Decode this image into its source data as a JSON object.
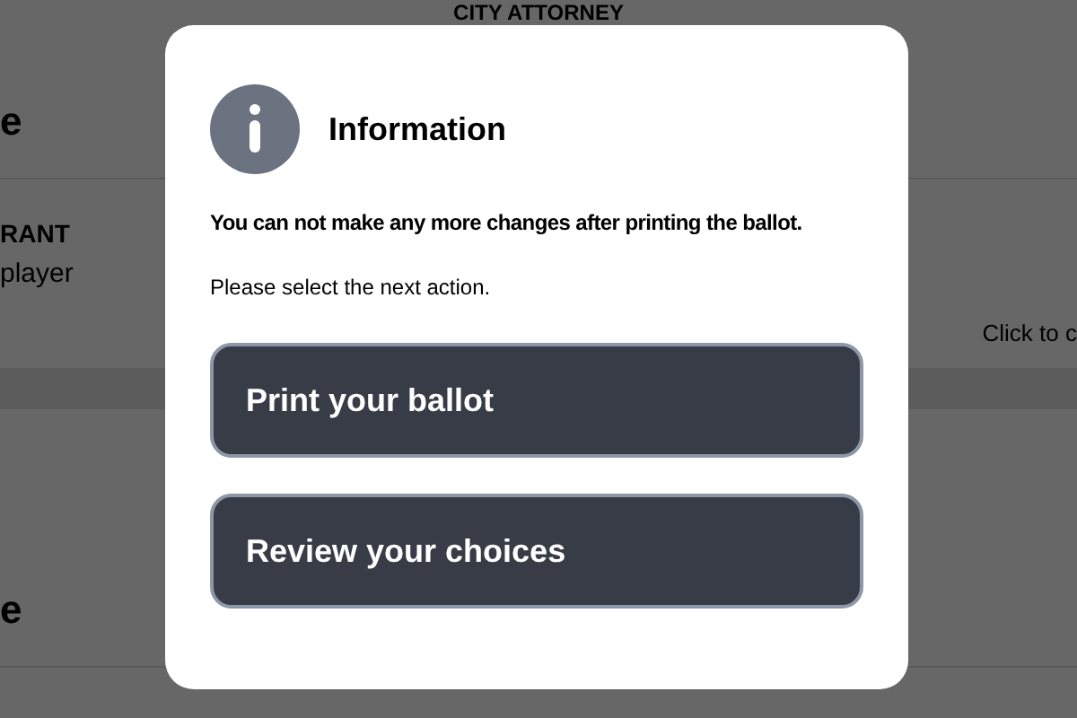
{
  "background": {
    "contest_title": "CITY ATTORNEY",
    "heading_1": "e",
    "candidate_name": "RANT",
    "candidate_party": "player",
    "hint": "Click to c",
    "heading_2": "e"
  },
  "dialog": {
    "title": "Information",
    "warning": "You can not make any more changes after printing the ballot.",
    "message": "Please select the next action.",
    "buttons": [
      {
        "label": "Print your ballot"
      },
      {
        "label": "Review your choices"
      }
    ]
  }
}
